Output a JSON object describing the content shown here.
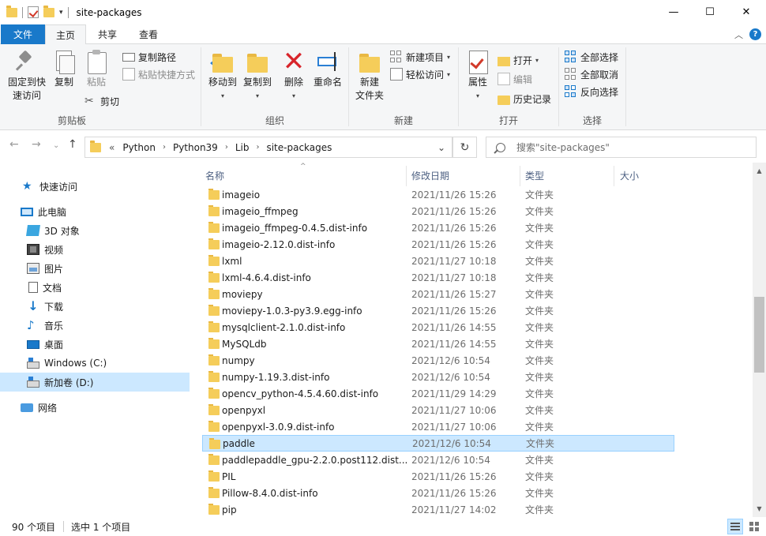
{
  "window": {
    "title": "site-packages",
    "controls": {
      "minimize": "—",
      "maximize": "☐",
      "close": "✕"
    }
  },
  "ribbon_tabs": {
    "file": "文件",
    "home": "主页",
    "share": "共享",
    "view": "查看"
  },
  "ribbon": {
    "clipboard": {
      "label": "剪贴板",
      "pin": "固定到快速访问",
      "pin_line1": "固定到快",
      "pin_line2": "速访问",
      "copy": "复制",
      "paste": "粘贴",
      "copy_path": "复制路径",
      "paste_shortcut": "粘贴快捷方式",
      "cut": "剪切"
    },
    "organize": {
      "label": "组织",
      "move_to": "移动到",
      "copy_to": "复制到",
      "delete": "删除",
      "rename": "重命名"
    },
    "new": {
      "label": "新建",
      "new_folder_line1": "新建",
      "new_folder_line2": "文件夹",
      "new_item": "新建项目",
      "easy_access": "轻松访问"
    },
    "open": {
      "label": "打开",
      "properties": "属性",
      "open": "打开",
      "edit": "编辑",
      "history": "历史记录"
    },
    "select": {
      "label": "选择",
      "select_all": "全部选择",
      "select_none": "全部取消",
      "invert": "反向选择"
    }
  },
  "address": {
    "overflow": "«",
    "crumbs": [
      "Python",
      "Python39",
      "Lib",
      "site-packages"
    ],
    "search_placeholder": "搜索\"site-packages\""
  },
  "nav": {
    "quick_access": "快速访问",
    "this_pc": "此电脑",
    "objects3d": "3D 对象",
    "videos": "视频",
    "pictures": "图片",
    "documents": "文档",
    "downloads": "下载",
    "music": "音乐",
    "desktop": "桌面",
    "drive_c": "Windows (C:)",
    "drive_d": "新加卷 (D:)",
    "network": "网络"
  },
  "columns": {
    "name": "名称",
    "modified": "修改日期",
    "type": "类型",
    "size": "大小"
  },
  "files": [
    {
      "name": "imageio",
      "date": "2021/11/26 15:26",
      "type": "文件夹"
    },
    {
      "name": "imageio_ffmpeg",
      "date": "2021/11/26 15:26",
      "type": "文件夹"
    },
    {
      "name": "imageio_ffmpeg-0.4.5.dist-info",
      "date": "2021/11/26 15:26",
      "type": "文件夹"
    },
    {
      "name": "imageio-2.12.0.dist-info",
      "date": "2021/11/26 15:26",
      "type": "文件夹"
    },
    {
      "name": "lxml",
      "date": "2021/11/27 10:18",
      "type": "文件夹"
    },
    {
      "name": "lxml-4.6.4.dist-info",
      "date": "2021/11/27 10:18",
      "type": "文件夹"
    },
    {
      "name": "moviepy",
      "date": "2021/11/26 15:27",
      "type": "文件夹"
    },
    {
      "name": "moviepy-1.0.3-py3.9.egg-info",
      "date": "2021/11/26 15:26",
      "type": "文件夹"
    },
    {
      "name": "mysqlclient-2.1.0.dist-info",
      "date": "2021/11/26 14:55",
      "type": "文件夹"
    },
    {
      "name": "MySQLdb",
      "date": "2021/11/26 14:55",
      "type": "文件夹"
    },
    {
      "name": "numpy",
      "date": "2021/12/6 10:54",
      "type": "文件夹"
    },
    {
      "name": "numpy-1.19.3.dist-info",
      "date": "2021/12/6 10:54",
      "type": "文件夹"
    },
    {
      "name": "opencv_python-4.5.4.60.dist-info",
      "date": "2021/11/29 14:29",
      "type": "文件夹"
    },
    {
      "name": "openpyxl",
      "date": "2021/11/27 10:06",
      "type": "文件夹"
    },
    {
      "name": "openpyxl-3.0.9.dist-info",
      "date": "2021/11/27 10:06",
      "type": "文件夹"
    },
    {
      "name": "paddle",
      "date": "2021/12/6 10:54",
      "type": "文件夹"
    },
    {
      "name": "paddlepaddle_gpu-2.2.0.post112.dist...",
      "date": "2021/12/6 10:54",
      "type": "文件夹"
    },
    {
      "name": "PIL",
      "date": "2021/11/26 15:26",
      "type": "文件夹"
    },
    {
      "name": "Pillow-8.4.0.dist-info",
      "date": "2021/11/26 15:26",
      "type": "文件夹"
    },
    {
      "name": "pip",
      "date": "2021/11/27 14:02",
      "type": "文件夹"
    }
  ],
  "selected_file": "paddle",
  "status": {
    "item_count": "90 个项目",
    "selected_count": "选中 1 个项目"
  },
  "colors": {
    "accent": "#1979ca",
    "selection": "#cce8ff",
    "folder": "#f5cd5a"
  }
}
